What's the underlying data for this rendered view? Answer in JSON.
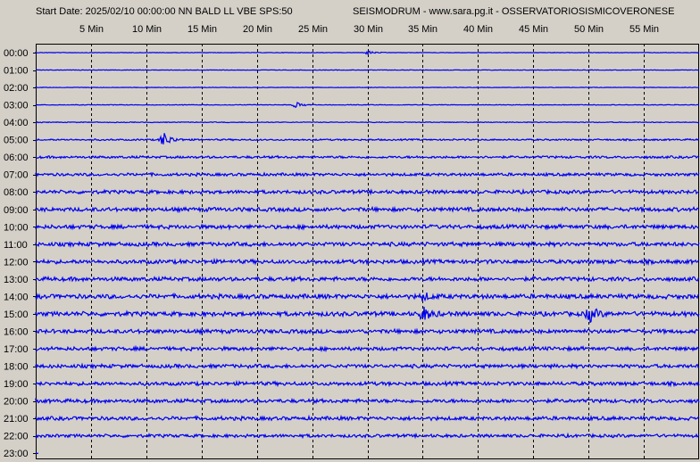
{
  "header": {
    "start_label": "Start Date: 2025/02/10 00:00:00 NN BALD LL VBE SPS:50",
    "station_title": "SEISMODRUM - www.sara.pg.it - OSSERVATORIOSISMICOVERONESE"
  },
  "colors": {
    "trace": "#0000ee",
    "plot_background": "#d4d0c8",
    "grid": "#000000"
  },
  "chart_data": {
    "type": "line",
    "x_axis": {
      "ticks": [
        "5 Min",
        "10 Min",
        "15 Min",
        "20 Min",
        "25 Min",
        "30 Min",
        "35 Min",
        "40 Min",
        "45 Min",
        "50 Min",
        "55 Min"
      ],
      "tick_values": [
        5,
        10,
        15,
        20,
        25,
        30,
        35,
        40,
        45,
        50,
        55
      ],
      "range": [
        0,
        60
      ],
      "unit": "minutes"
    },
    "y_axis": {
      "ticks": [
        "00:00",
        "01:00",
        "02:00",
        "03:00",
        "04:00",
        "05:00",
        "06:00",
        "07:00",
        "08:00",
        "09:00",
        "10:00",
        "11:00",
        "12:00",
        "13:00",
        "14:00",
        "15:00",
        "16:00",
        "17:00",
        "18:00",
        "19:00",
        "20:00",
        "21:00",
        "22:00",
        "23:00"
      ]
    },
    "grid": "dashed vertical every 5 min",
    "noise_amplitude_per_hour": [
      0.3,
      0.3,
      0.3,
      0.4,
      0.5,
      1.0,
      1.5,
      1.8,
      2.2,
      2.5,
      2.5,
      2.5,
      2.5,
      2.5,
      2.8,
      2.8,
      2.5,
      2.3,
      2.3,
      2.3,
      2.3,
      2.3,
      2.0,
      0.5
    ],
    "trace_end_minute_last_hour": 0.3,
    "events": [
      {
        "hour": "00:00",
        "minute": 30.0,
        "amplitude": 2
      },
      {
        "hour": "03:00",
        "minute": 23.5,
        "amplitude": 3
      },
      {
        "hour": "05:00",
        "minute": 11.5,
        "amplitude": 9
      },
      {
        "hour": "14:00",
        "minute": 35.0,
        "amplitude": 4
      },
      {
        "hour": "15:00",
        "minute": 35.0,
        "amplitude": 8
      },
      {
        "hour": "15:00",
        "minute": 50.0,
        "amplitude": 9
      }
    ]
  }
}
